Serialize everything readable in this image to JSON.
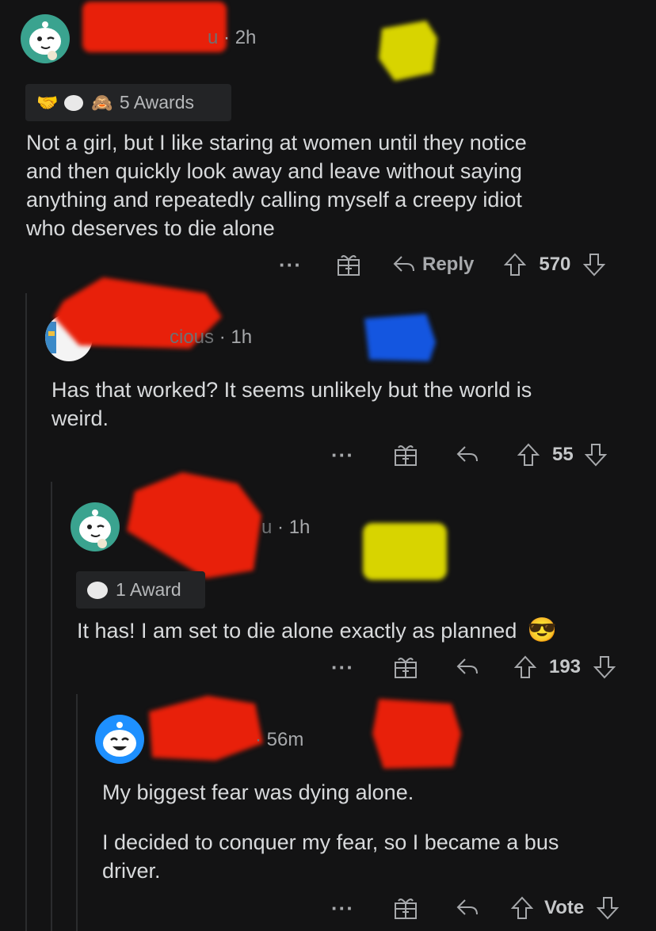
{
  "comments": [
    {
      "username_visible": "u",
      "time": "2h",
      "awards_label": "5 Awards",
      "body": [
        "Not a girl, but I like staring at women until they notice",
        "and then quickly look away and leave without saying",
        "anything and repeatedly calling myself a creepy idiot",
        "who deserves to die alone"
      ],
      "reply_label": "Reply",
      "score": "570"
    },
    {
      "username_visible": "cious",
      "time": "1h",
      "body": [
        "Has that worked? It seems unlikely but the world is",
        "weird."
      ],
      "score": "55"
    },
    {
      "username_visible": "u",
      "time": "1h",
      "awards_label": "1 Award",
      "body": [
        "It has! I am set to die alone exactly as planned"
      ],
      "emoji": "😎",
      "score": "193"
    },
    {
      "time": "56m",
      "body_p1": "My biggest fear was dying alone.",
      "body_p2": [
        "I decided to conquer my fear, so I became a bus",
        "driver."
      ],
      "score": "Vote"
    }
  ],
  "colors": {
    "background": "#131314",
    "redaction_red": "#e8200a",
    "redaction_yellow": "#d8d400",
    "redaction_blue": "#1456e0",
    "avatar_teal": "#3aa38f"
  },
  "icons": [
    "snoo-avatar",
    "gift-icon",
    "reply-arrow-icon",
    "upvote-icon",
    "downvote-icon",
    "more-dots-icon"
  ]
}
